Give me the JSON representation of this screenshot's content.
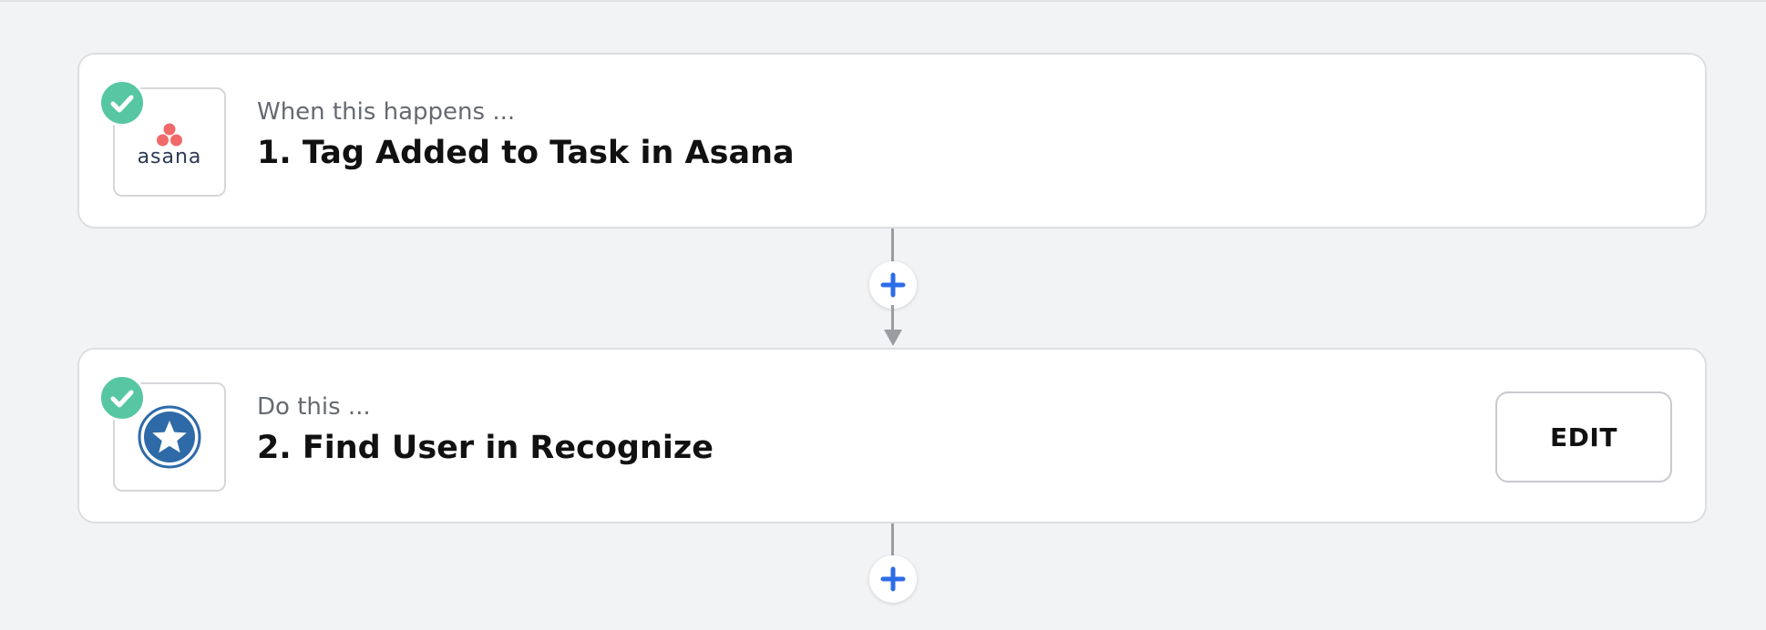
{
  "steps": [
    {
      "app": "asana",
      "kicker": "When this happens ...",
      "title": "1. Tag Added to Task in Asana",
      "logo_text": "asana",
      "status": "check-complete"
    },
    {
      "app": "recognize",
      "kicker": "Do this ...",
      "title": "2. Find User in Recognize",
      "edit_label": "EDIT",
      "status": "check-complete"
    }
  ],
  "colors": {
    "page_bg": "#f2f3f5",
    "check_green": "#57c7a3",
    "plus_blue": "#2d6ce8",
    "asana_coral": "#f06a6a",
    "recognize_blue": "#2f6aa8",
    "connector_gray": "#9a9ca0"
  },
  "icons": {
    "check": "check-icon",
    "plus": "plus-icon",
    "asana": "asana-logo-icon",
    "recognize": "star-badge-icon"
  }
}
